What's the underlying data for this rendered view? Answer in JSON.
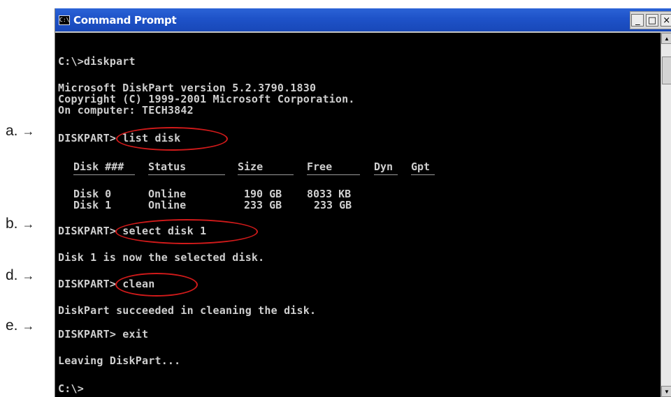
{
  "window": {
    "title": "Command Prompt",
    "icon_text": "C:\\",
    "controls": [
      "_",
      "□",
      "×"
    ]
  },
  "annotations": {
    "a": "a.",
    "b": "b.",
    "d": "d.",
    "e": "e.",
    "arrow": "→"
  },
  "console": {
    "l1": "C:\\>diskpart",
    "l2": "Microsoft DiskPart version 5.2.3790.1830",
    "l3": "Copyright (C) 1999-2001 Microsoft Corporation.",
    "l4": "On computer: TECH3842",
    "l5": "DISKPART> list disk",
    "table": {
      "headers": [
        "Disk ###",
        "Status",
        "Size",
        "Free",
        "Dyn",
        "Gpt"
      ],
      "rows": [
        [
          "Disk 0",
          "Online",
          "190 GB",
          "8033 KB",
          "",
          ""
        ],
        [
          "Disk 1",
          "Online",
          "233 GB",
          "233 GB",
          "",
          ""
        ]
      ]
    },
    "l6": "DISKPART> select disk 1",
    "l7": "Disk 1 is now the selected disk.",
    "l8": "DISKPART> clean",
    "l9": "DiskPart succeeded in cleaning the disk.",
    "l10": "DISKPART> exit",
    "l11": "Leaving DiskPart...",
    "l12": "C:\\>"
  },
  "colors": {
    "highlight_ellipse": "#d11a1a",
    "console_bg": "#000000",
    "console_text": "#cfcfcf",
    "titlebar": "#1e52c8"
  }
}
